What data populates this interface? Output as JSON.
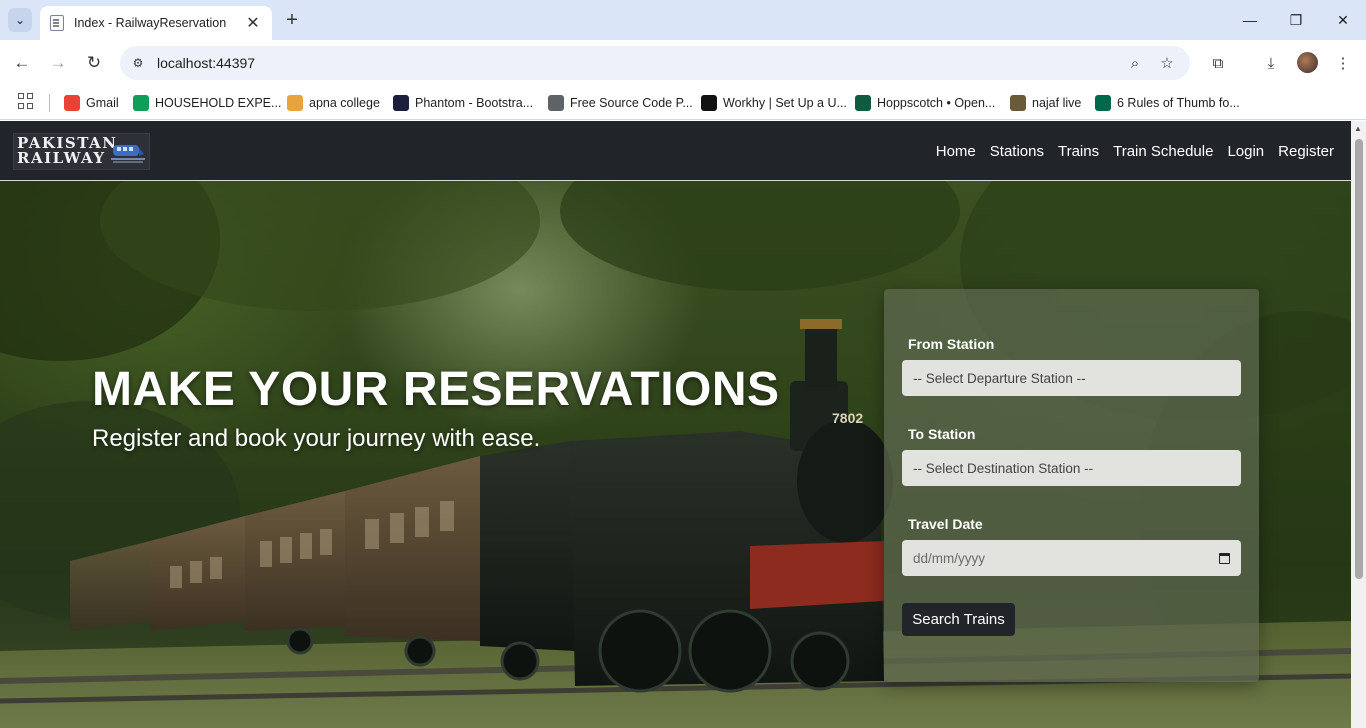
{
  "browser": {
    "tab_title": "Index - RailwayReservation",
    "url": "localhost:44397",
    "bookmarks": [
      {
        "label": "Gmail",
        "icon": "gmail-icon",
        "color": "#ea4335"
      },
      {
        "label": "HOUSEHOLD EXPE...",
        "icon": "sheets-icon",
        "color": "#0f9d58"
      },
      {
        "label": "apna college",
        "icon": "apna-college-icon",
        "color": "#e8a33d"
      },
      {
        "label": "Phantom - Bootstra...",
        "icon": "phantom-icon",
        "color": "#1b1f3b"
      },
      {
        "label": "Free Source Code P...",
        "icon": "globe-icon",
        "color": "#5f6368"
      },
      {
        "label": "Workhy | Set Up a U...",
        "icon": "workhy-icon",
        "color": "#111111"
      },
      {
        "label": "Hoppscotch • Open...",
        "icon": "hoppscotch-icon",
        "color": "#0d5c3f"
      },
      {
        "label": "najaf live",
        "icon": "najaf-icon",
        "color": "#6b5a3a"
      },
      {
        "label": "6 Rules of Thumb fo...",
        "icon": "mongodb-icon",
        "color": "#00684a"
      }
    ]
  },
  "site": {
    "logo_line1": "PAKISTAN",
    "logo_line2": "RAILWAY",
    "nav": [
      "Home",
      "Stations",
      "Trains",
      "Train Schedule",
      "Login",
      "Register"
    ],
    "nav_bg": "#212529"
  },
  "hero": {
    "title": "MAKE YOUR RESERVATIONS",
    "subtitle": "Register and book your journey with ease.",
    "locomotive_number": "7802"
  },
  "booking": {
    "from_label": "From Station",
    "from_placeholder": "-- Select Departure Station --",
    "to_label": "To Station",
    "to_placeholder": "-- Select Destination Station --",
    "date_label": "Travel Date",
    "date_placeholder": "dd/mm/yyyy",
    "submit_label": "Search Trains"
  }
}
